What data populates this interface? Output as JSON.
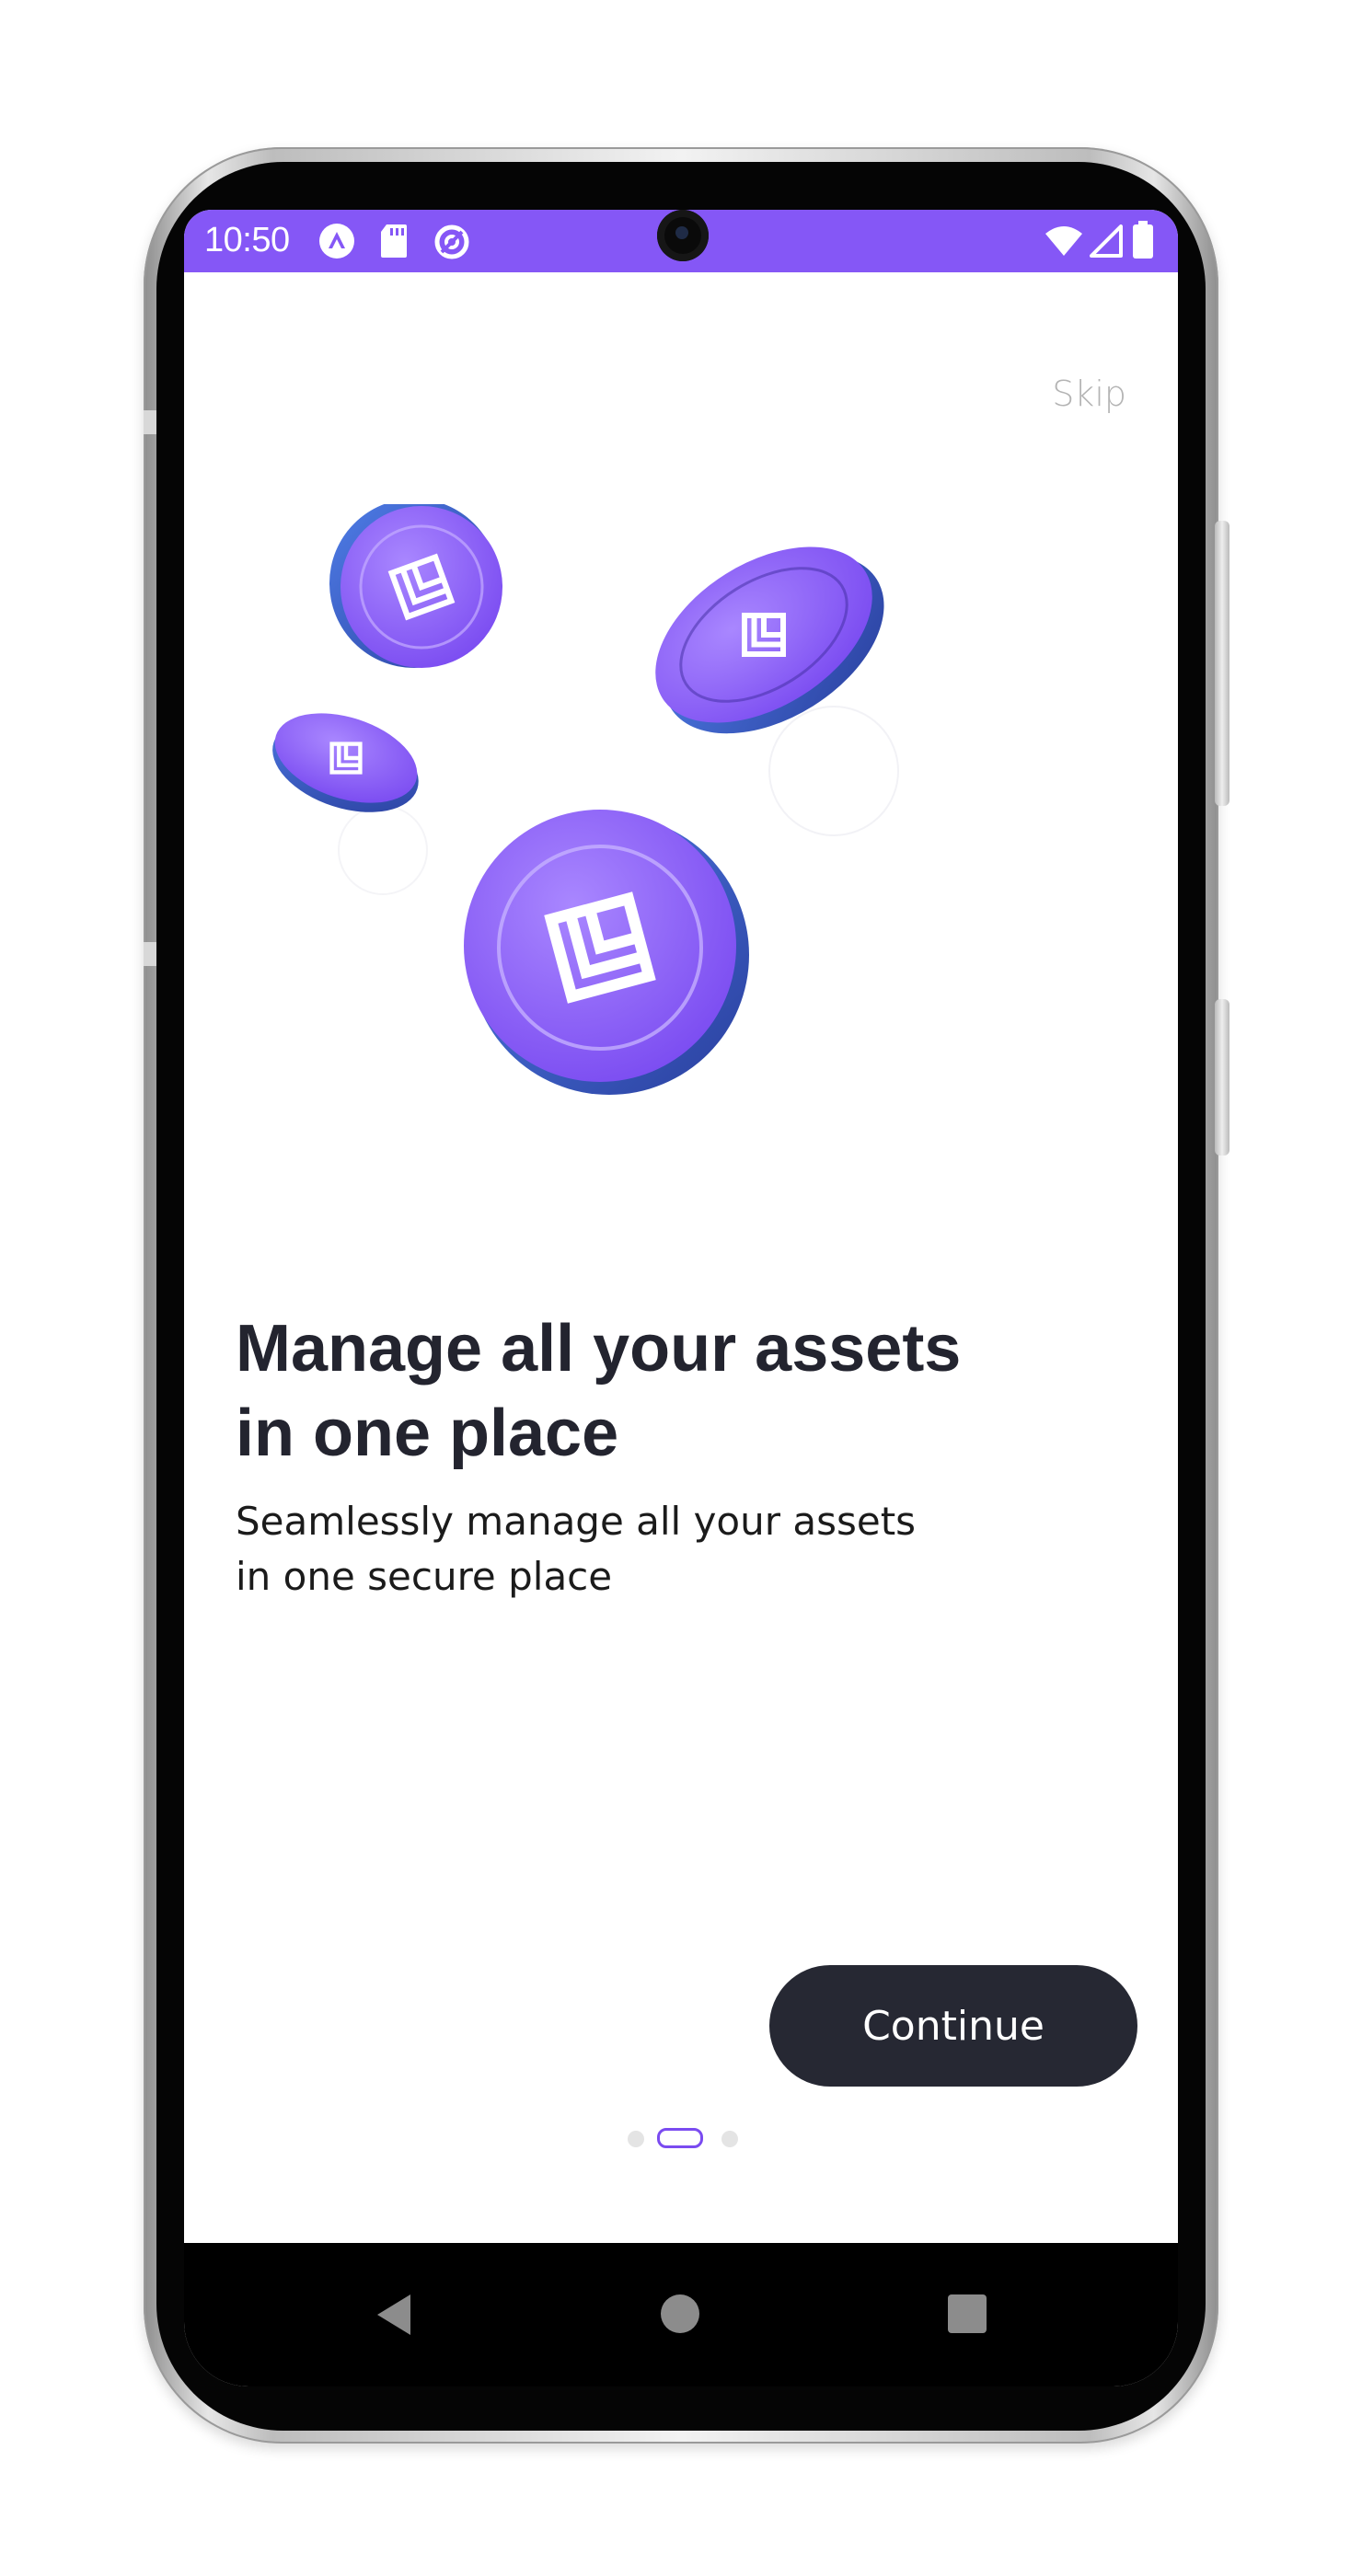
{
  "status_bar": {
    "time": "10:50",
    "background": "#8557F6",
    "left_icons": [
      "expo-icon",
      "sd-card-icon",
      "data-saver-icon"
    ],
    "right_icons": [
      "wifi-icon",
      "cellular-signal-icon",
      "battery-icon"
    ]
  },
  "onboarding": {
    "skip_label": "Skip",
    "headline_line1": "Manage all your assets",
    "headline_line2": "in one place",
    "subtitle_line1": "Seamlessly manage all your assets",
    "subtitle_line2": "in one secure place",
    "continue_label": "Continue",
    "page_count": 3,
    "active_page": 2,
    "accent_color": "#8557F6",
    "button_color": "#262833",
    "illustration": "purple-coins-with-logo-illustration"
  },
  "navigation_bar": {
    "buttons": [
      "back-icon",
      "home-icon",
      "recent-apps-icon"
    ]
  }
}
